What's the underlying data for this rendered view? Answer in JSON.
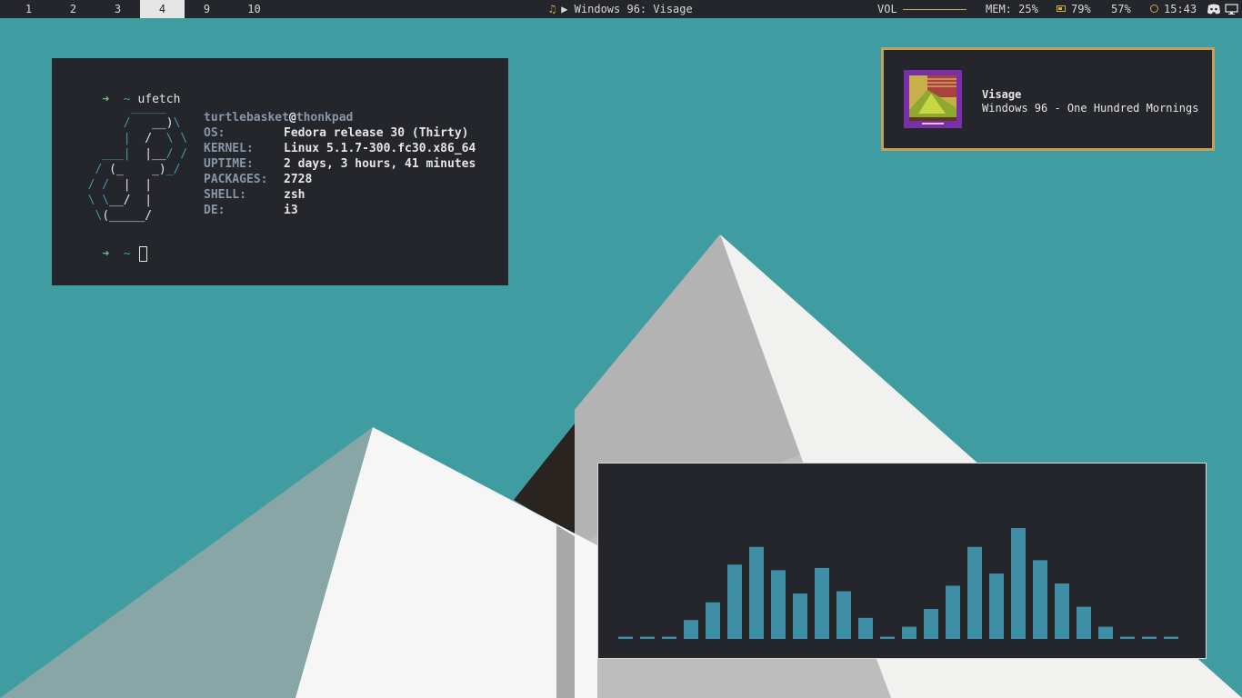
{
  "topbar": {
    "workspaces": [
      "1",
      "2",
      "3",
      "4",
      "9",
      "10"
    ],
    "active_workspace": "4",
    "now_playing": "▶ Windows 96: Visage",
    "volume_label": "VOL",
    "mem": "MEM: 25%",
    "battery": "79%",
    "brightness": "57%",
    "clock": "15:43",
    "tray_icons": [
      "discord-icon",
      "monitor-icon"
    ]
  },
  "terminal": {
    "prompt_arrow": "➜",
    "prompt_tilde": "~",
    "command": "ufetch",
    "user": "turtlebasket",
    "at": "@",
    "host": "thonkpad",
    "info": [
      {
        "key": "OS:",
        "value": "Fedora release 30 (Thirty)"
      },
      {
        "key": "KERNEL:",
        "value": "Linux 5.1.7-300.fc30.x86_64"
      },
      {
        "key": "UPTIME:",
        "value": "2 days, 3 hours, 41 minutes"
      },
      {
        "key": "PACKAGES:",
        "value": "2728"
      },
      {
        "key": "SHELL:",
        "value": "zsh"
      },
      {
        "key": "DE:",
        "value": "i3"
      }
    ]
  },
  "notification": {
    "title": "Visage",
    "body": "Windows 96 - One Hundred Mornings",
    "border_color": "#c4a15a"
  },
  "visualizer": {
    "levels": [
      0.02,
      0.02,
      0.02,
      0.17,
      0.33,
      0.67,
      0.83,
      0.62,
      0.41,
      0.64,
      0.43,
      0.19,
      0.02,
      0.11,
      0.27,
      0.48,
      0.83,
      0.59,
      1.0,
      0.71,
      0.5,
      0.29,
      0.11,
      0.02,
      0.02,
      0.02
    ],
    "bar_color": "#3e8fa5"
  },
  "colors": {
    "bar_bg": "#24262c",
    "accent": "#d4a94c",
    "teal": "#3f9da1"
  }
}
